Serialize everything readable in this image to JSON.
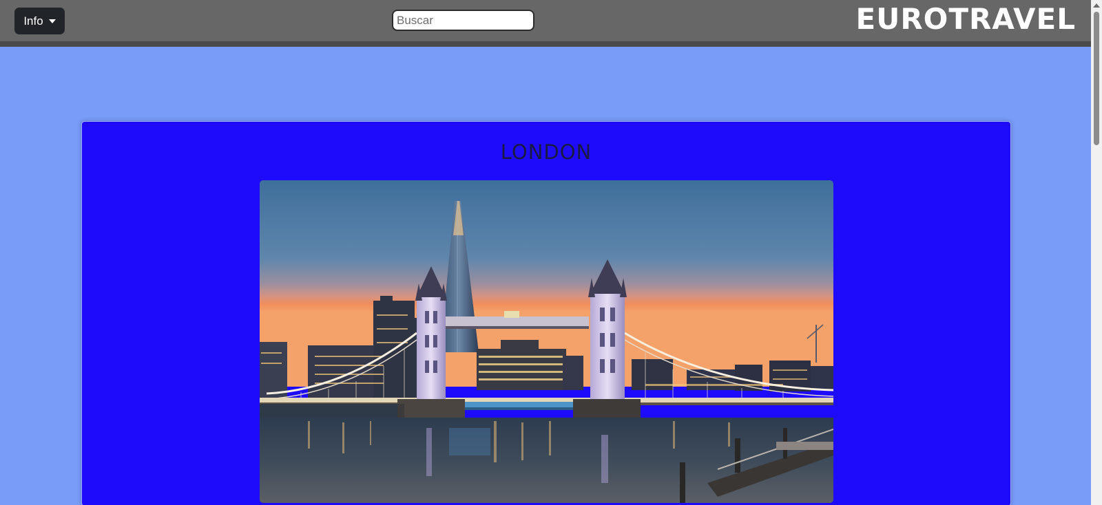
{
  "navbar": {
    "info_label": "Info",
    "search_placeholder": "Buscar",
    "search_value": "",
    "brand": "EUROTRAVEL"
  },
  "card": {
    "title": "LONDON",
    "image_alt": "Tower Bridge at dusk"
  },
  "icons": {
    "dropdown": "caret-down-icon",
    "scroll": "scroll-up-arrow-icon"
  },
  "colors": {
    "page_background": "#789cf7",
    "navbar": "#676767",
    "card_background": "#1e0bfc",
    "info_button": "#212529"
  }
}
